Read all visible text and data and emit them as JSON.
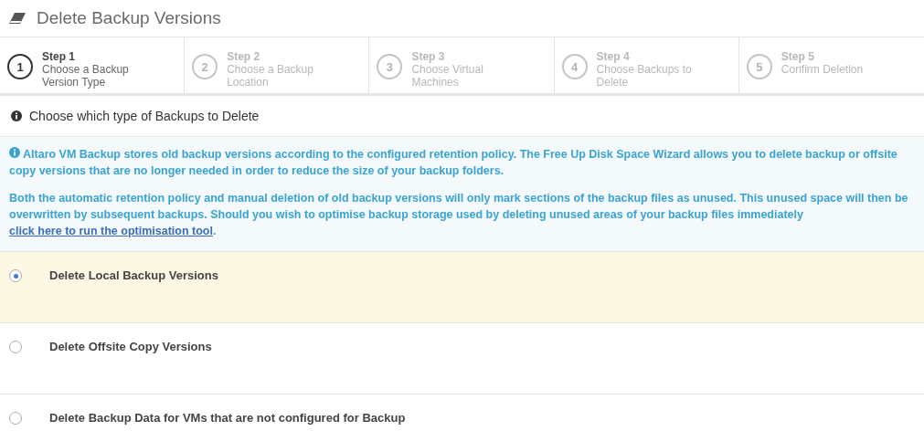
{
  "window": {
    "title": "Delete Backup Versions"
  },
  "steps": [
    {
      "number": "1",
      "title": "Step 1",
      "label": "Choose a Backup Version Type",
      "selected": true
    },
    {
      "number": "2",
      "title": "Step 2",
      "label": "Choose a Backup Location",
      "selected": false
    },
    {
      "number": "3",
      "title": "Step 3",
      "label": "Choose Virtual Machines",
      "selected": false
    },
    {
      "number": "4",
      "title": "Step 4",
      "label": "Choose Backups to Delete",
      "selected": false
    },
    {
      "number": "5",
      "title": "Step 5",
      "label": "Confirm Deletion",
      "selected": false
    }
  ],
  "section": {
    "heading": "Choose which type of Backups to Delete"
  },
  "info": {
    "paragraph_1": "Altaro VM Backup stores old backup versions according to the configured retention policy. The Free Up Disk Space Wizard allows you to delete backup or offsite copy versions that are no longer needed in order to reduce the size of your backup folders.",
    "paragraph_2": "Both the automatic retention policy and manual deletion of old backup versions will only mark sections of the backup files as unused. This unused space will then be overwritten by subsequent backups. Should you wish to optimise backup storage used by deleting unused areas of your backup files immediately",
    "link": "click here to run the optimisation tool",
    "after_link": "."
  },
  "options": [
    {
      "label": "Delete Local Backup Versions",
      "selected": true
    },
    {
      "label": "Delete Offsite Copy Versions",
      "selected": false
    },
    {
      "label": "Delete Backup Data for VMs that are not configured for Backup",
      "selected": false
    }
  ]
}
